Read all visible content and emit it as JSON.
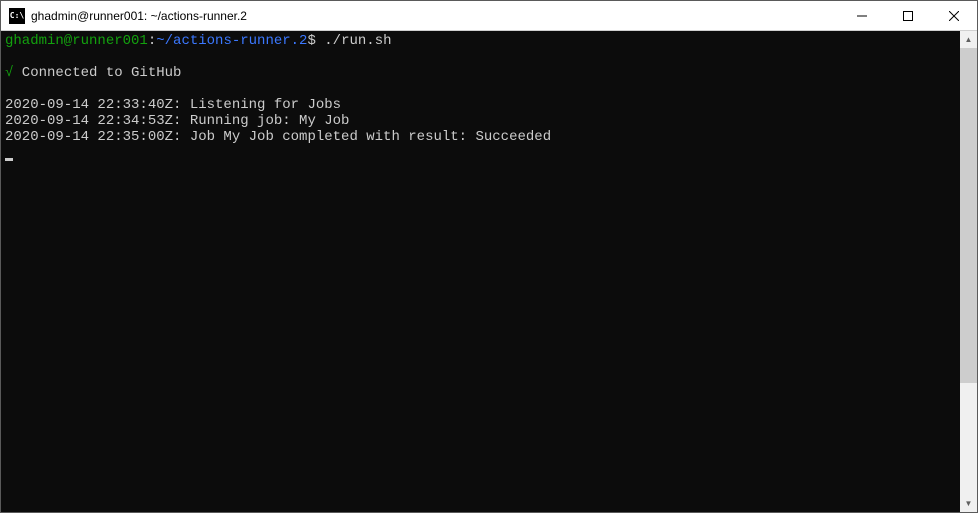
{
  "window": {
    "title": "ghadmin@runner001: ~/actions-runner.2"
  },
  "prompt": {
    "userhost": "ghadmin@runner001",
    "sep": ":",
    "path": "~/actions-runner.2",
    "dollar": "$",
    "command": "./run.sh"
  },
  "status": {
    "check": "√",
    "connected": " Connected to GitHub"
  },
  "log": {
    "line1": "2020-09-14 22:33:40Z: Listening for Jobs",
    "line2": "2020-09-14 22:34:53Z: Running job: My Job",
    "line3": "2020-09-14 22:35:00Z: Job My Job completed with result: Succeeded"
  }
}
